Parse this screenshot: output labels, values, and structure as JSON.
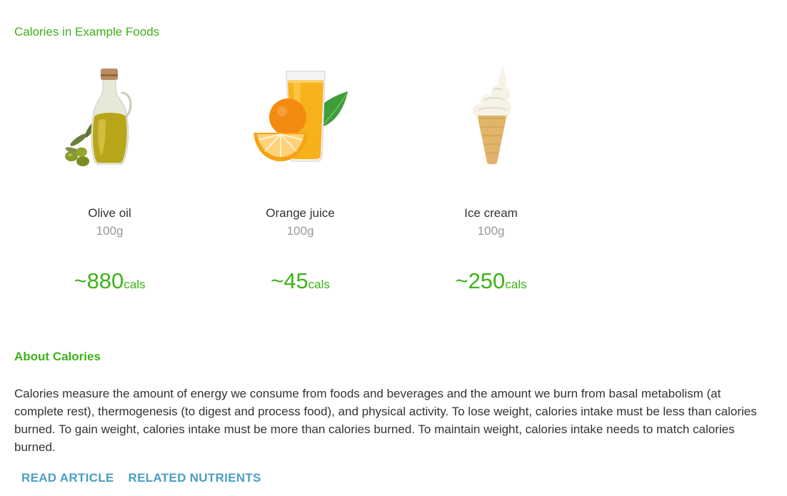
{
  "section": {
    "title": "Calories in Example Foods"
  },
  "foods": [
    {
      "name": "Olive oil",
      "amount": "100g",
      "calories_prefix": "~",
      "calories_value": "880",
      "calories_unit": "cals"
    },
    {
      "name": "Orange juice",
      "amount": "100g",
      "calories_prefix": "~",
      "calories_value": "45",
      "calories_unit": "cals"
    },
    {
      "name": "Ice cream",
      "amount": "100g",
      "calories_prefix": "~",
      "calories_value": "250",
      "calories_unit": "cals"
    }
  ],
  "about": {
    "title": "About Calories",
    "text": "Calories measure the amount of energy we consume from foods and beverages and the amount we burn from basal metabolism (at complete rest), thermogenesis (to digest and process food), and physical activity. To lose weight, calories intake must be less than calories burned. To gain weight, calories intake must be more than calories burned. To maintain weight, calories intake needs to match calories burned."
  },
  "links": {
    "read_article": "READ ARTICLE",
    "related_nutrients": "RELATED NUTRIENTS"
  },
  "colors": {
    "accent_green": "#3cb318",
    "link_blue": "#4a9ec2",
    "muted_gray": "#999999"
  },
  "icons": [
    "olive-oil-bottle-image",
    "orange-juice-glass-image",
    "ice-cream-cone-image"
  ]
}
